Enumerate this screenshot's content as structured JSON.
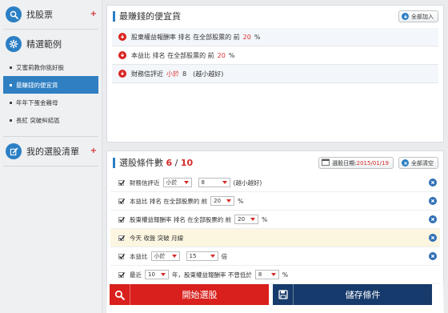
{
  "sidebar": {
    "find_stocks": "找股票",
    "featured": "精選範例",
    "featured_items": [
      "艾蜜莉教你挑好股",
      "最賺錢的便宜貨",
      "年年下蛋金雞母",
      "長紅 突破糾結區"
    ],
    "active_index": 1,
    "my_list": "我的選股清單",
    "plus": "+"
  },
  "top_panel": {
    "title": "最賺錢的便宜貨",
    "add_all": "全部加入",
    "rows": [
      {
        "pre": "股東權益報酬率 排名 在全部股票的 前",
        "num": "20",
        "post": "%"
      },
      {
        "pre": "本益比 排名 在全部股票的 前",
        "num": "20",
        "post": "%"
      },
      {
        "pre": "財務信評近",
        "num": "小於",
        "post": "8　(越小越好)"
      }
    ]
  },
  "criteria": {
    "title": "選股條件數",
    "count": "6",
    "sep": "/",
    "max": "10",
    "date_label": "選股日期:",
    "date_value": "2015/01/19",
    "clear_all": "全部清空",
    "rows": [
      {
        "a": "財務信評近",
        "s1": "小於",
        "s2": "8",
        "b": "(越小越好)"
      },
      {
        "a": "本益比 排名 在全部股票的 前",
        "s1": "20",
        "b": "%"
      },
      {
        "a": "股東權益報酬率 排名 在全部股票的 前",
        "s1": "20",
        "b": "%"
      },
      {
        "a": "今天 收盤 突破 月線"
      },
      {
        "a": "本益比",
        "s1": "小於",
        "s2": "15",
        "b": "倍"
      },
      {
        "a": "最近",
        "s1": "10",
        "b": "年，股東權益報酬率 不曾低於",
        "s2": "8",
        "c": "%"
      }
    ]
  },
  "actions": {
    "start": "開始選股",
    "save": "儲存條件"
  },
  "colors": {
    "accent_blue": "#2b7fc4",
    "active_blue": "#2f7fc2",
    "red": "#d9201c",
    "navy": "#163a6b"
  }
}
